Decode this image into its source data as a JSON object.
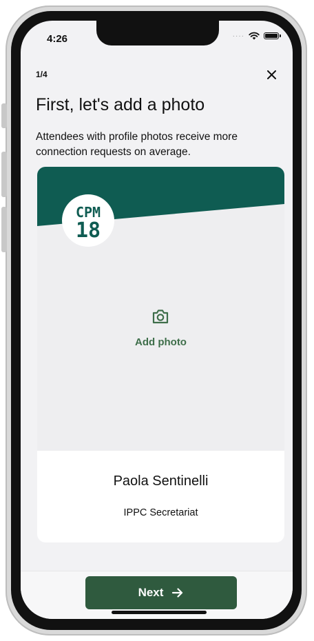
{
  "status_bar": {
    "time": "4:26"
  },
  "header": {
    "step": "1/4"
  },
  "title": "First, let's add a photo",
  "subtitle": "Attendees with profile photos receive more connection requests on average.",
  "card": {
    "logo": {
      "line1": "CPM",
      "line2": "18"
    },
    "add_photo_label": "Add photo",
    "name": "Paola Sentinelli",
    "organization": "IPPC Secretariat"
  },
  "footer": {
    "next_label": "Next"
  },
  "colors": {
    "brand_dark_green": "#0f5c52",
    "button_green": "#2f5a3e",
    "accent_green": "#3e6e4a",
    "screen_bg": "#f2f2f4"
  },
  "icons": {
    "close": "close-icon",
    "camera": "camera-icon",
    "arrow": "arrow-right-icon",
    "wifi": "wifi-icon",
    "battery": "battery-icon"
  }
}
